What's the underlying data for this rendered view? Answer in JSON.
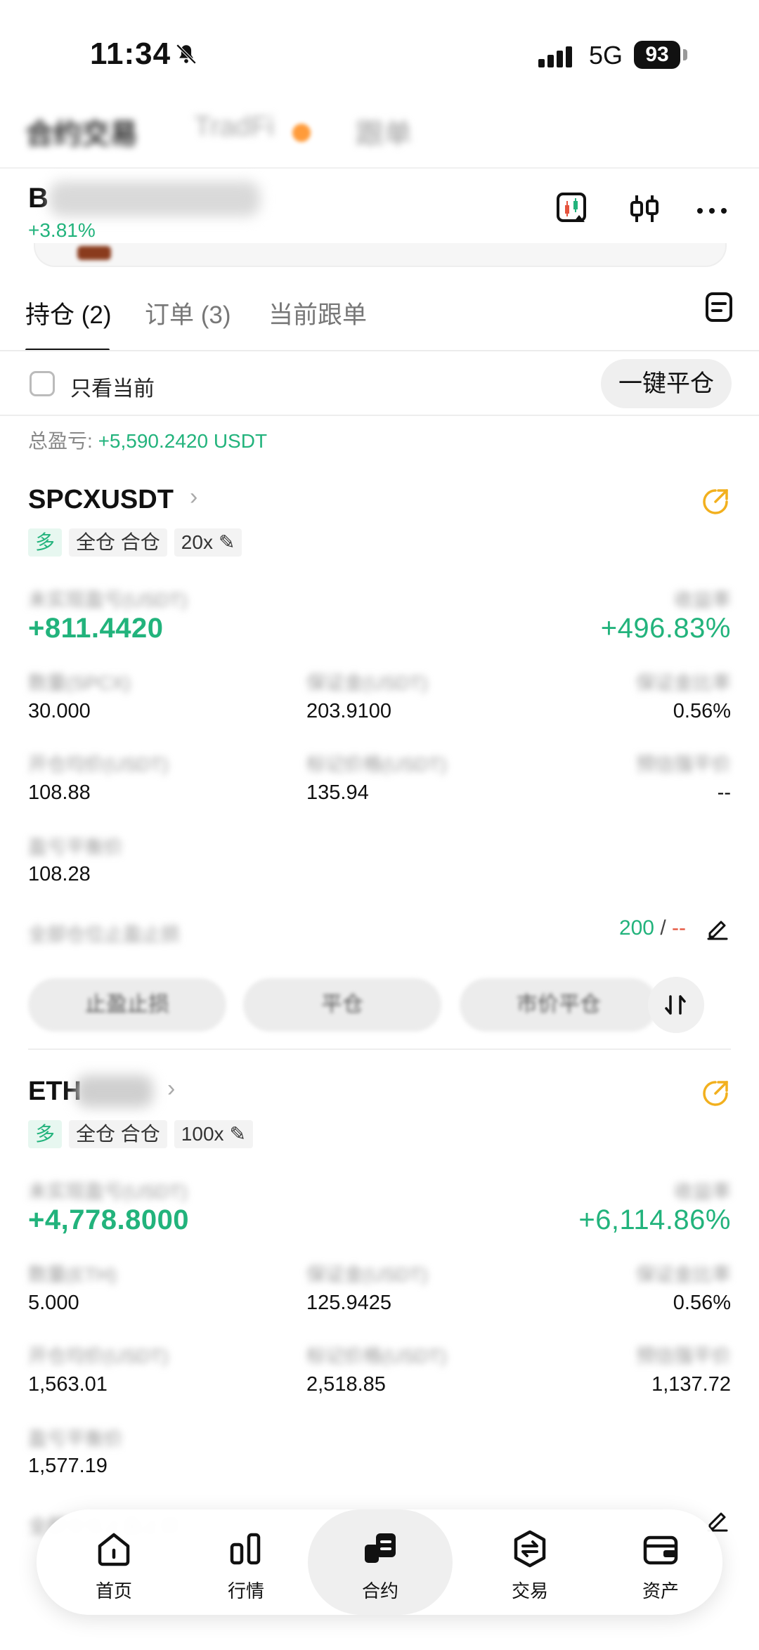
{
  "status_bar": {
    "time": "11:34",
    "network": "5G",
    "battery": "93"
  },
  "top_tabs": [
    "合约交易",
    "TradFi",
    "跟单"
  ],
  "symbol_header": {
    "symbol_prefix": "B",
    "change": "+3.81%"
  },
  "position_tabs": [
    {
      "label": "持仓 (2)",
      "active": true
    },
    {
      "label": "订单 (3)",
      "active": false
    },
    {
      "label": "当前跟单",
      "active": false
    }
  ],
  "filter": {
    "only_current": "只看当前",
    "close_all": "一键平仓"
  },
  "total": {
    "label": "总盈亏: ",
    "value": "+5,590.2420 USDT"
  },
  "positions": [
    {
      "pair": "SPCXUSDT",
      "tags": {
        "side": "多",
        "margin": "全仓 合仓",
        "leverage": "20x"
      },
      "unrealized_label": "未实现盈亏(USDT)",
      "unrealized": "+811.4420",
      "roi_label": "收益率",
      "roi": "+496.83%",
      "qty_label": "数量(SPCX)",
      "qty": "30.000",
      "margin_label": "保证金(USDT)",
      "margin": "203.9100",
      "margin_ratio_label": "保证金比率",
      "margin_ratio": "0.56%",
      "entry_label": "开仓均价(USDT)",
      "entry": "108.88",
      "mark_label": "标记价格(USDT)",
      "mark": "135.94",
      "liq_label": "预估强平价",
      "liq": "--",
      "breakeven_label": "盈亏平衡价",
      "breakeven": "108.28",
      "tpsl_label": "全部仓位止盈止损",
      "tp": "200",
      "sep": " / ",
      "sl": "--",
      "actions": [
        "止盈止损",
        "平仓",
        "市价平仓"
      ]
    },
    {
      "pair": "ETH",
      "tags": {
        "side": "多",
        "margin": "全仓 合仓",
        "leverage": "100x"
      },
      "unrealized_label": "未实现盈亏(USDT)",
      "unrealized": "+4,778.8000",
      "roi_label": "收益率",
      "roi": "+6,114.86%",
      "qty_label": "数量(ETH)",
      "qty": "5.000",
      "margin_label": "保证金(USDT)",
      "margin": "125.9425",
      "margin_ratio_label": "保证金比率",
      "margin_ratio": "0.56%",
      "entry_label": "开仓均价(USDT)",
      "entry": "1,563.01",
      "mark_label": "标记价格(USDT)",
      "mark": "2,518.85",
      "liq_label": "预估强平价",
      "liq": "1,137.72",
      "breakeven_label": "盈亏平衡价",
      "breakeven": "1,577.19",
      "tpsl_label": "全部仓位止盈止损"
    }
  ],
  "bottom_nav": [
    {
      "label": "首页",
      "icon": "home-icon"
    },
    {
      "label": "行情",
      "icon": "chart-bars-icon"
    },
    {
      "label": "合约",
      "icon": "contract-icon",
      "active": true
    },
    {
      "label": "交易",
      "icon": "exchange-icon"
    },
    {
      "label": "资产",
      "icon": "wallet-icon"
    }
  ],
  "colors": {
    "green": "#22b37c",
    "orange": "#e5533d",
    "accent_yellow": "#f2b01e"
  }
}
